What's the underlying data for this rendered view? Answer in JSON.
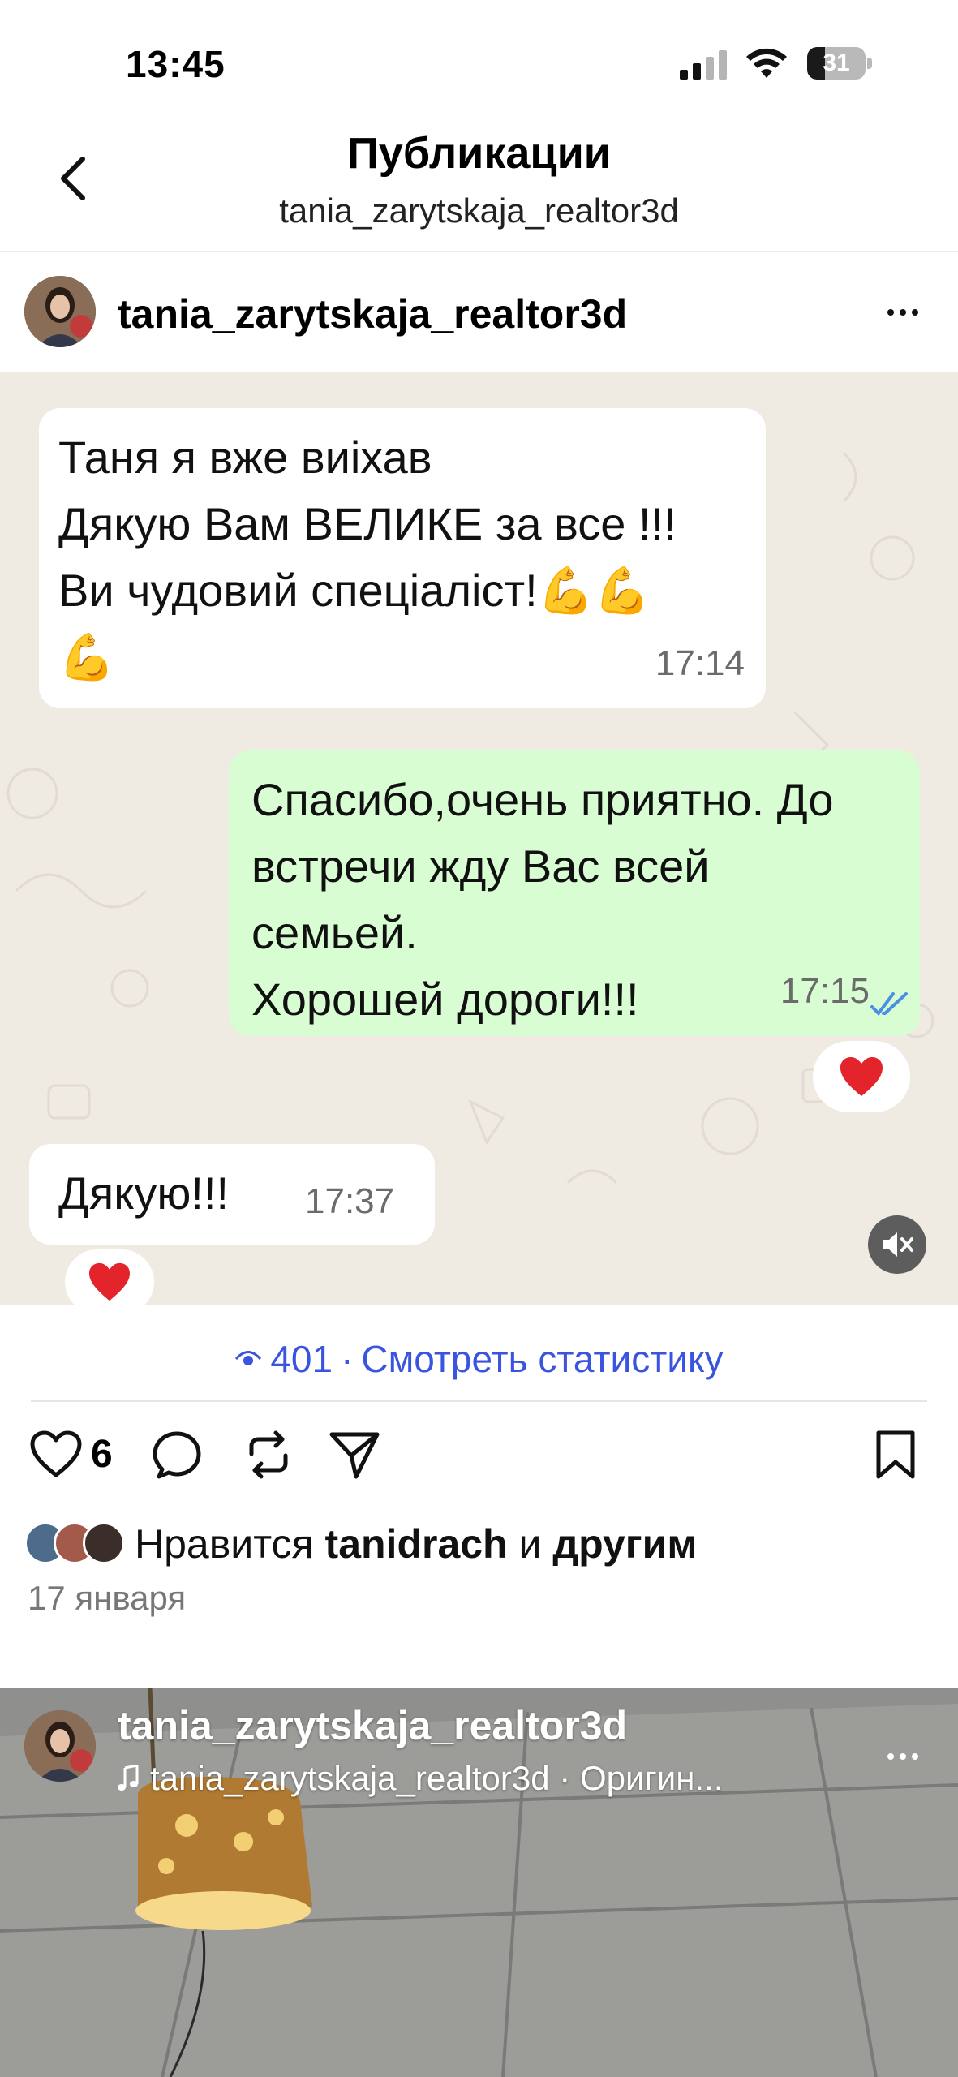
{
  "status_bar": {
    "time": "13:45",
    "battery": "31",
    "battery_level": 0.31
  },
  "nav": {
    "title": "Публикации",
    "subtitle": "tania_zarytskaja_realtor3d"
  },
  "post": {
    "username": "tania_zarytskaja_realtor3d",
    "messages": [
      {
        "direction": "incoming",
        "text": "Таня я вже виіхав\nДякую Вам ВЕЛИКЕ за все !!!\nВи чудовий спеціаліст!💪💪\n💪",
        "time": "17:14"
      },
      {
        "direction": "outgoing",
        "text": "Спасибо,очень приятно. До\nвстречи жду Вас всей\nсемьей.\nХорошей дороги!!!",
        "time": "17:15",
        "reaction": "❤️"
      },
      {
        "direction": "incoming",
        "text": "Дякую!!!",
        "time": "17:37",
        "reaction": "❤️"
      }
    ],
    "views_count": "401",
    "views_link": "Смотреть статистику",
    "views_separator": "·",
    "like_count": "6",
    "likes": {
      "prefix": "Нравится",
      "user": "tanidrach",
      "conj": "и",
      "others": "другим"
    },
    "date": "17 января",
    "colors": {
      "accent_link": "#3a54e0",
      "outgoing_bubble": "#d9fdd3",
      "incoming_bubble": "#ffffff",
      "chat_background": "#efeae2"
    }
  },
  "next_reel": {
    "username": "tania_zarytskaja_realtor3d",
    "audio": "tania_zarytskaja_realtor3d · Оригин..."
  },
  "icons": [
    "back-chevron-icon",
    "signal-icon",
    "wifi-icon",
    "battery-icon",
    "more-icon",
    "mute-icon",
    "eye-icon",
    "heart-icon",
    "comment-icon",
    "repost-icon",
    "share-icon",
    "bookmark-icon",
    "music-note-icon",
    "double-check-icon"
  ]
}
